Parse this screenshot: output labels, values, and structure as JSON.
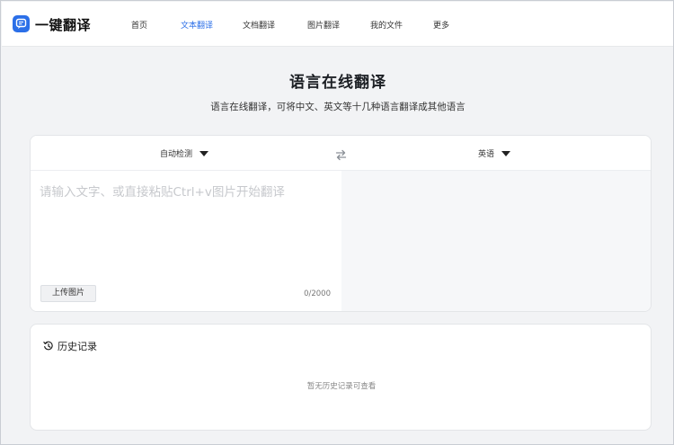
{
  "header": {
    "brand": "一键翻译",
    "nav": [
      {
        "label": "首页"
      },
      {
        "label": "文本翻译",
        "active": true
      },
      {
        "label": "文档翻译"
      },
      {
        "label": "图片翻译"
      },
      {
        "label": "我的文件"
      },
      {
        "label": "更多"
      }
    ]
  },
  "hero": {
    "title": "语言在线翻译",
    "subtitle": "语言在线翻译，可将中文、英文等十几种语言翻译成其他语言"
  },
  "translator": {
    "source_lang": "自动检测",
    "target_lang": "英语",
    "input_value": "",
    "input_placeholder": "请输入文字、或直接粘贴Ctrl+v图片开始翻译",
    "upload_label": "上传图片",
    "counter": "0/2000",
    "swap_icon": "swap-icon"
  },
  "history": {
    "title": "历史记录",
    "empty_text": "暂无历史记录可查看",
    "icon": "history-icon"
  },
  "colors": {
    "accent": "#2b6fe8",
    "page_bg": "#f2f3f5"
  }
}
